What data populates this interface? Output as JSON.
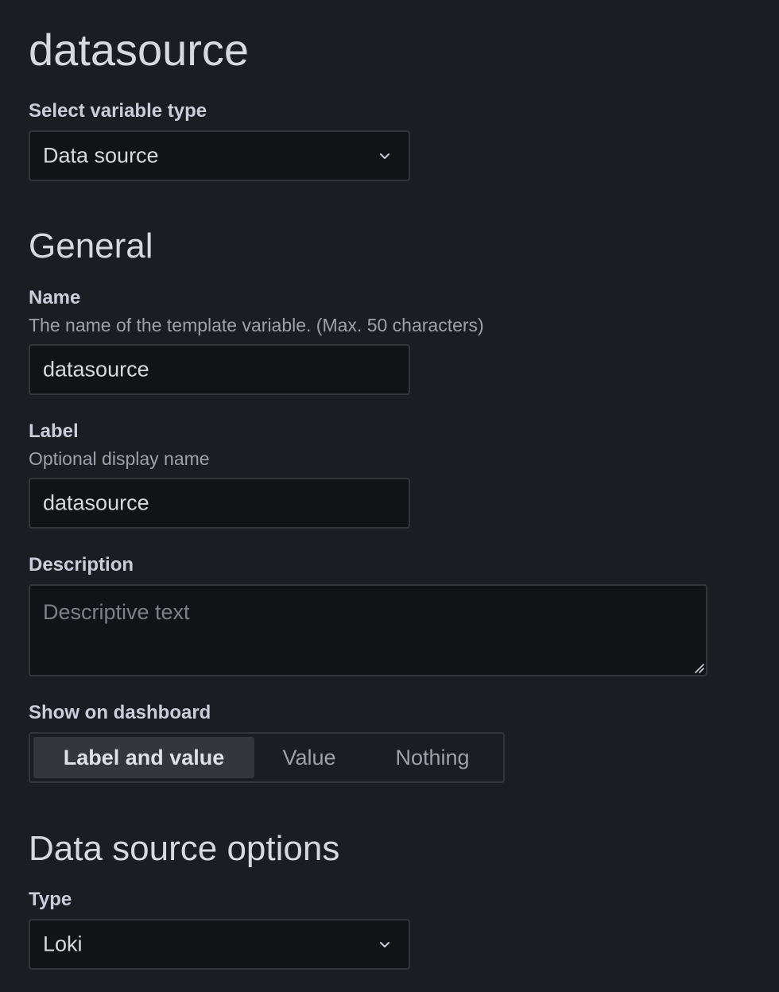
{
  "title": "datasource",
  "variable_type": {
    "label": "Select variable type",
    "value": "Data source"
  },
  "general": {
    "heading": "General",
    "name": {
      "label": "Name",
      "description": "The name of the template variable. (Max. 50 characters)",
      "value": "datasource"
    },
    "label_field": {
      "label": "Label",
      "description": "Optional display name",
      "value": "datasource"
    },
    "description_field": {
      "label": "Description",
      "placeholder": "Descriptive text",
      "value": ""
    },
    "show_on_dashboard": {
      "label": "Show on dashboard",
      "options": [
        "Label and value",
        "Value",
        "Nothing"
      ],
      "selected": "Label and value"
    }
  },
  "datasource_options": {
    "heading": "Data source options",
    "type": {
      "label": "Type",
      "value": "Loki"
    }
  },
  "icons": {
    "dropdown": "chevron-down-icon",
    "resize": "resize-handle-icon"
  },
  "colors": {
    "background": "#1c1d22",
    "input_background": "#121317",
    "border": "#34353b",
    "text": "#d8d9de",
    "muted_text": "#9da1ab",
    "active_option": "#34363d"
  }
}
